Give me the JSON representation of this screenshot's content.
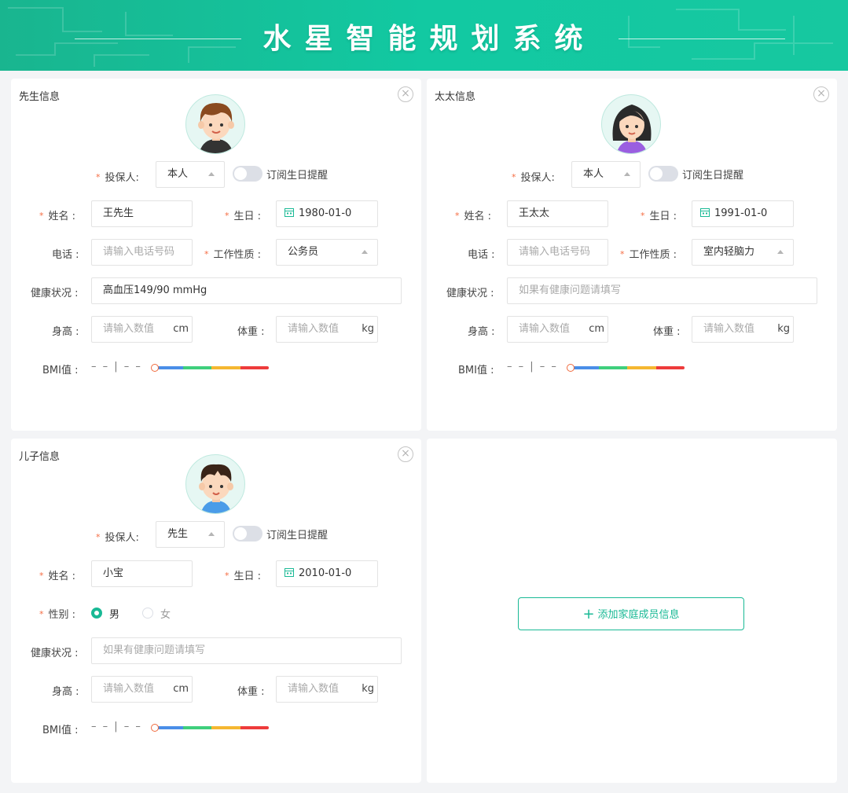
{
  "app": {
    "title": "水星智能规划系统"
  },
  "cards": [
    {
      "title": "先生信息",
      "close": "×",
      "insured_label": "投保人:",
      "insured_value": "本人",
      "subscribe_label": "订阅生日提醒",
      "name_label": "姓名 :",
      "name_value": "王先生",
      "birthday_label": "生日 :",
      "birthday_value": "1980-01-0",
      "phone_label": "电话 :",
      "phone_placeholder": "请输入电话号码",
      "job_label": "工作性质 :",
      "job_value": "公务员",
      "health_label": "健康状况 :",
      "health_value": "高血压149/90 mmHg",
      "health_placeholder": "",
      "height_label": "身高 :",
      "height_placeholder": "请输入数值",
      "height_unit": "cm",
      "weight_label": "体重 :",
      "weight_placeholder": "请输入数值",
      "weight_unit": "kg",
      "bmi_label": "BMI值 :",
      "bmi_value": "– –  |  – –"
    },
    {
      "title": "太太信息",
      "close": "×",
      "insured_label": "投保人:",
      "insured_value": "本人",
      "subscribe_label": "订阅生日提醒",
      "name_label": "姓名 :",
      "name_value": "王太太",
      "birthday_label": "生日 :",
      "birthday_value": "1991-01-0",
      "phone_label": "电话 :",
      "phone_placeholder": "请输入电话号码",
      "job_label": "工作性质 :",
      "job_value": "室内轻脑力",
      "health_label": "健康状况 :",
      "health_value": "",
      "health_placeholder": "如果有健康问题请填写",
      "height_label": "身高 :",
      "height_placeholder": "请输入数值",
      "height_unit": "cm",
      "weight_label": "体重 :",
      "weight_placeholder": "请输入数值",
      "weight_unit": "kg",
      "bmi_label": "BMI值 :",
      "bmi_value": "– –  |  – –"
    },
    {
      "title": "儿子信息",
      "close": "×",
      "insured_label": "投保人:",
      "insured_value": "先生",
      "subscribe_label": "订阅生日提醒",
      "name_label": "姓名 :",
      "name_value": "小宝",
      "birthday_label": "生日 :",
      "birthday_value": "2010-01-0",
      "gender_label": "性别 :",
      "gender_options": [
        "男",
        "女"
      ],
      "gender_selected": "男",
      "health_label": "健康状况 :",
      "health_value": "",
      "health_placeholder": "如果有健康问题请填写",
      "height_label": "身高 :",
      "height_placeholder": "请输入数值",
      "height_unit": "cm",
      "weight_label": "体重 :",
      "weight_placeholder": "请输入数值",
      "weight_unit": "kg",
      "bmi_label": "BMI值 :",
      "bmi_value": "– –  |  – –"
    }
  ],
  "add_member": {
    "label": "添加家庭成员信息",
    "icon": "plus-icon"
  },
  "colors": {
    "accent": "#19b995",
    "required": "#f56c42",
    "bmi_segments": [
      "#4a8ee8",
      "#3fcf7c",
      "#f5b731",
      "#ee3b3b"
    ]
  }
}
